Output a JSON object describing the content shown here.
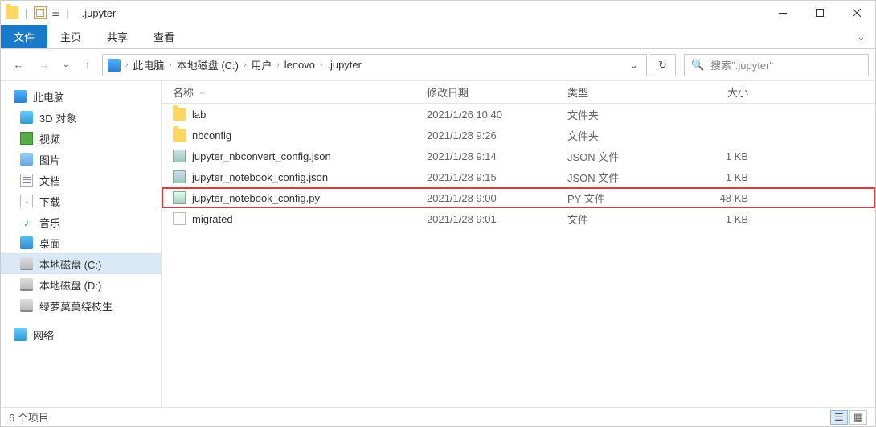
{
  "window": {
    "title": ".jupyter"
  },
  "ribbon": {
    "file": "文件",
    "tabs": [
      "主页",
      "共享",
      "查看"
    ]
  },
  "breadcrumb": {
    "items": [
      "此电脑",
      "本地磁盘 (C:)",
      "用户",
      "lenovo",
      ".jupyter"
    ]
  },
  "search": {
    "placeholder": "搜索\".jupyter\""
  },
  "sidebar": {
    "thispc": "此电脑",
    "items": [
      {
        "label": "3D 对象",
        "icon": "i-3d"
      },
      {
        "label": "视频",
        "icon": "i-vid"
      },
      {
        "label": "图片",
        "icon": "i-img"
      },
      {
        "label": "文档",
        "icon": "i-doc"
      },
      {
        "label": "下载",
        "icon": "i-dl"
      },
      {
        "label": "音乐",
        "icon": "i-mus",
        "glyph": "♪"
      },
      {
        "label": "桌面",
        "icon": "i-desk"
      },
      {
        "label": "本地磁盘 (C:)",
        "icon": "i-drive",
        "selected": true
      },
      {
        "label": "本地磁盘 (D:)",
        "icon": "i-drive"
      },
      {
        "label": "绿萝莫莫绕枝生",
        "icon": "i-drive"
      }
    ],
    "network": "网络"
  },
  "columns": {
    "name": "名称",
    "date": "修改日期",
    "type": "类型",
    "size": "大小"
  },
  "files": [
    {
      "name": "lab",
      "date": "2021/1/26 10:40",
      "type": "文件夹",
      "size": "",
      "icon": "i-folder"
    },
    {
      "name": "nbconfig",
      "date": "2021/1/28 9:26",
      "type": "文件夹",
      "size": "",
      "icon": "i-folder"
    },
    {
      "name": "jupyter_nbconvert_config.json",
      "date": "2021/1/28 9:14",
      "type": "JSON 文件",
      "size": "1 KB",
      "icon": "i-json"
    },
    {
      "name": "jupyter_notebook_config.json",
      "date": "2021/1/28 9:15",
      "type": "JSON 文件",
      "size": "1 KB",
      "icon": "i-json"
    },
    {
      "name": "jupyter_notebook_config.py",
      "date": "2021/1/28 9:00",
      "type": "PY 文件",
      "size": "48 KB",
      "icon": "i-py",
      "highlight": true
    },
    {
      "name": "migrated",
      "date": "2021/1/28 9:01",
      "type": "文件",
      "size": "1 KB",
      "icon": "i-file"
    }
  ],
  "status": {
    "count": "6 个项目"
  }
}
